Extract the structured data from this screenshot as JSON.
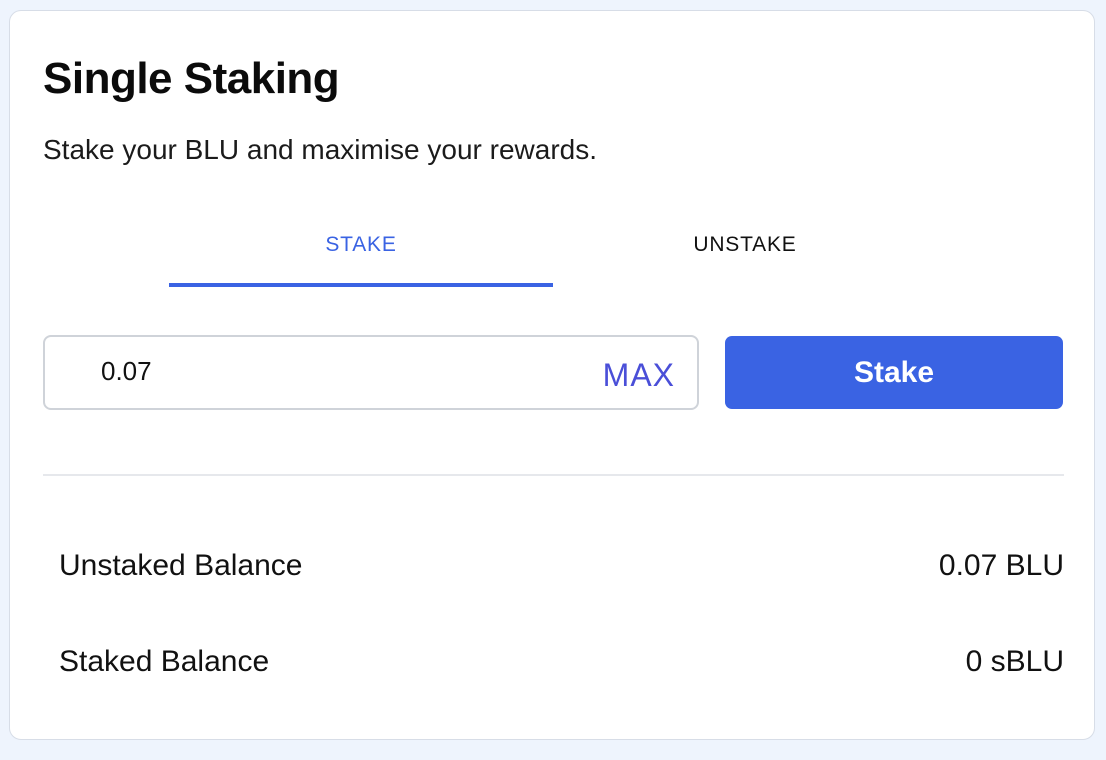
{
  "card": {
    "title": "Single Staking",
    "subtitle": "Stake your BLU and maximise your rewards."
  },
  "tabs": [
    {
      "label": "STAKE",
      "active": true
    },
    {
      "label": "UNSTAKE",
      "active": false
    }
  ],
  "form": {
    "amount_value": "0.07",
    "max_label": "MAX",
    "submit_label": "Stake"
  },
  "balances": [
    {
      "label": "Unstaked Balance",
      "value": "0.07 BLU"
    },
    {
      "label": "Staked Balance",
      "value": "0 sBLU"
    }
  ],
  "colors": {
    "accent": "#3a63e3",
    "max_link": "#4a4fd8",
    "page_background": "#eef4fd",
    "card_background": "#ffffff"
  }
}
